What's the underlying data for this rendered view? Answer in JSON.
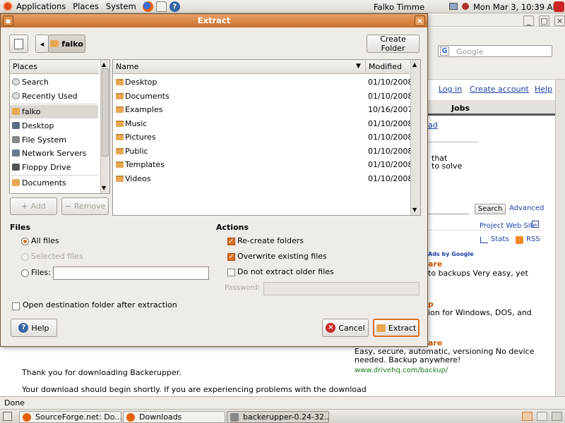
{
  "panel": {
    "menus": [
      "Applications",
      "Places",
      "System"
    ],
    "user": "Falko Timme",
    "clock": "Mon Mar  3, 10:39 AM"
  },
  "taskbar": {
    "items": [
      "SourceForge.net: Do...",
      "Downloads",
      "backerupper-0.24-32..."
    ]
  },
  "browser": {
    "search_placeholder": "Google",
    "login": "Log in",
    "create_account": "Create account",
    "help": "Help",
    "jobs_tab": "Jobs",
    "partial_link": "ad",
    "text_that": "that",
    "text_solve": "to solve",
    "search_btn": "Search",
    "advanced": "Advanced",
    "project_site": "Project Web Site",
    "stats": "Stats",
    "rss": "RSS",
    "ads_by": "Ads by Google",
    "ad1_title": "are",
    "ad1_text": "to backups Very easy, yet",
    "ad2_title": "p",
    "ad2_text": "ion for Windows, DOS, and",
    "ad3_title": "are",
    "ad3_text1": "Easy, secure, automatic, versioning No device",
    "ad3_text2": "needed. Backup anywhere!",
    "ad3_url": "www.drivehq.com/backup/",
    "thanks": "Thank you for downloading Backerupper.",
    "download_text": "Your download should begin shortly. If you are experiencing problems with the download",
    "status": "Done"
  },
  "dialog": {
    "title": "Extract",
    "path_button": "falko",
    "create_folder": "Create Folder",
    "places_header": "Places",
    "places": [
      "Search",
      "Recently Used",
      "falko",
      "Desktop",
      "File System",
      "Network Servers",
      "Floppy Drive",
      "Documents"
    ],
    "name_header": "Name",
    "modified_header": "Modified",
    "files": [
      {
        "name": "Desktop",
        "date": "01/10/2008"
      },
      {
        "name": "Documents",
        "date": "01/10/2008"
      },
      {
        "name": "Examples",
        "date": "10/16/2007"
      },
      {
        "name": "Music",
        "date": "01/10/2008"
      },
      {
        "name": "Pictures",
        "date": "01/10/2008"
      },
      {
        "name": "Public",
        "date": "01/10/2008"
      },
      {
        "name": "Templates",
        "date": "01/10/2008"
      },
      {
        "name": "Videos",
        "date": "01/10/2008"
      }
    ],
    "add_label": "Add",
    "remove_label": "Remove",
    "files_section": "Files",
    "all_files": "All files",
    "selected_files": "Selected files",
    "files_label": "Files:",
    "files_value": "",
    "actions_section": "Actions",
    "recreate_folders": "Re-create folders",
    "overwrite_files": "Overwrite existing files",
    "no_extract_older": "Do not extract older files",
    "password_label": "Password:",
    "password_value": "",
    "open_destination": "Open destination folder after extraction",
    "help": "Help",
    "cancel": "Cancel",
    "extract": "Extract"
  },
  "colors": {
    "accent": "#d96e22",
    "title_bar": "#c9712d",
    "link": "#1c3fa8"
  }
}
